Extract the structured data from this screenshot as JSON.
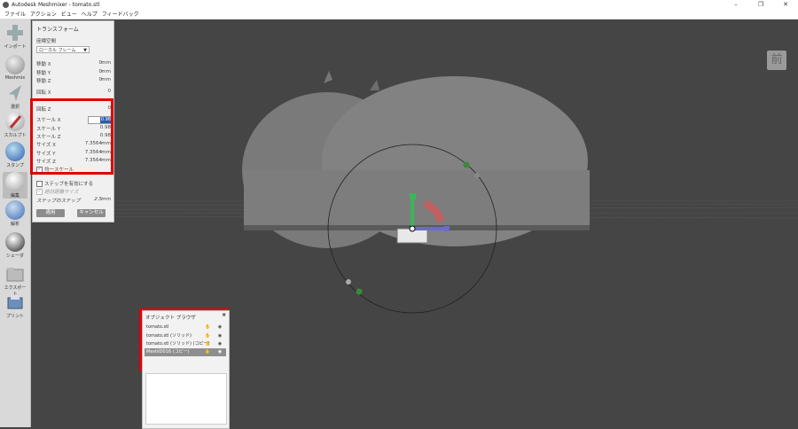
{
  "window": {
    "title": "Autodesk Meshmixer - tomato.stl",
    "min": "–",
    "max": "❐",
    "close": "✕"
  },
  "menu": [
    "ファイル",
    "アクション",
    "ビュー",
    "ヘルプ",
    "フィードバック"
  ],
  "tools": [
    "インポート",
    "Meshmix",
    "選択",
    "スカルプト",
    "スタンプ",
    "編集",
    "解析",
    "シェーダ",
    "エクスポート",
    "プリント"
  ],
  "transform": {
    "header": "トランスフォーム",
    "coord_label": "座標空間",
    "coord_value": "ローカル フレーム",
    "move_x": {
      "k": "移動 X",
      "v": "0",
      "u": "mm"
    },
    "move_y": {
      "k": "移動 Y",
      "v": "0",
      "u": "mm"
    },
    "move_z": {
      "k": "移動 Z",
      "v": "0",
      "u": "mm"
    },
    "rot_x": {
      "k": "回転 X",
      "v": "0"
    },
    "rot_z": {
      "k": "回転 Z",
      "v": "0"
    },
    "scale_x": {
      "k": "スケール X",
      "v": "0.98"
    },
    "scale_y": {
      "k": "スケール Y",
      "v": "0.98"
    },
    "scale_z": {
      "k": "スケール Z",
      "v": "0.98"
    },
    "size_x": {
      "k": "サイズ X",
      "v": "7.3564",
      "u": "mm"
    },
    "size_y": {
      "k": "サイズ Y",
      "v": "7.3564",
      "u": "mm"
    },
    "size_z": {
      "k": "サイズ Z",
      "v": "7.3564",
      "u": "mm"
    },
    "uniform_scale": "均一スケール",
    "snap_step": "ステップを有効にする",
    "absolute_size": "絶対距離サイズ",
    "step_label": "ステップのステップ",
    "step_value": "2.5",
    "step_unit": "mm",
    "apply": "適用",
    "cancel": "キャンセル"
  },
  "object_browser": {
    "title": "オブジェクト ブラウザ",
    "close": "✖",
    "items": [
      "tomato.stl",
      "tomato.stl (ソリッド)",
      "tomato.stl (ソリッド) (コピー)",
      "MeshID016 (コピー)"
    ],
    "selected_index": 3
  },
  "view_cube_label": "前",
  "colors": {
    "highlight": "#e00000",
    "viewport": "#454545",
    "selection": "#2a5db0"
  }
}
